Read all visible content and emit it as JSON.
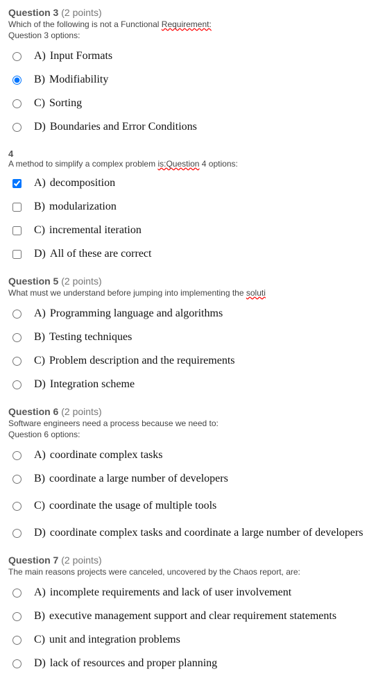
{
  "q3": {
    "title": "Question 3",
    "points": "(2 points)",
    "text_before": "Which of the following is not a Functional ",
    "text_spell": "Requirement:",
    "options_label": "Question 3 options:",
    "opts": [
      {
        "letter": "A)",
        "text": "Input Formats",
        "selected": false
      },
      {
        "letter": "B)",
        "text": "Modifiability",
        "selected": true
      },
      {
        "letter": "C)",
        "text": "Sorting",
        "selected": false
      },
      {
        "letter": "D)",
        "text": "Boundaries and Error Conditions",
        "selected": false
      }
    ]
  },
  "q4": {
    "num": "4",
    "text_before": "A method to simplify a complex problem ",
    "text_spell": "is:Question",
    "text_after": " 4 options:",
    "opts": [
      {
        "letter": "A)",
        "text": "decomposition",
        "selected": true
      },
      {
        "letter": "B)",
        "text": "modularization",
        "selected": false
      },
      {
        "letter": "C)",
        "text": "incremental iteration",
        "selected": false
      },
      {
        "letter": "D)",
        "text": "All of these are correct",
        "selected": false
      }
    ]
  },
  "q5": {
    "title": "Question 5",
    "points": "(2 points)",
    "text_before": "What must we understand before jumping into implementing the ",
    "text_spell": "soluti",
    "opts": [
      {
        "letter": "A)",
        "text": "Programming language and algorithms"
      },
      {
        "letter": "B)",
        "text": "Testing techniques"
      },
      {
        "letter": "C)",
        "text": "Problem description and the requirements"
      },
      {
        "letter": "D)",
        "text": "Integration scheme"
      }
    ]
  },
  "q6": {
    "title": "Question 6",
    "points": "(2 points)",
    "text": "Software engineers need a process because we need to:",
    "options_label": "Question 6 options:",
    "opts": [
      {
        "letter": "A)",
        "text": "coordinate complex tasks"
      },
      {
        "letter": "B)",
        "text": "coordinate a large number of developers"
      },
      {
        "letter": "C)",
        "text": "coordinate the usage of multiple tools"
      },
      {
        "letter": "D)",
        "text": "coordinate complex tasks and coordinate a large number of developers"
      }
    ]
  },
  "q7": {
    "title": "Question 7",
    "points": "(2 points)",
    "text": "The main reasons projects were canceled, uncovered by the Chaos report, are:",
    "opts": [
      {
        "letter": "A)",
        "text": "incomplete requirements and lack of user involvement"
      },
      {
        "letter": "B)",
        "text": "executive management support and clear requirement statements"
      },
      {
        "letter": "C)",
        "text": "unit and integration problems"
      },
      {
        "letter": "D)",
        "text": "lack of resources and proper planning"
      }
    ]
  }
}
